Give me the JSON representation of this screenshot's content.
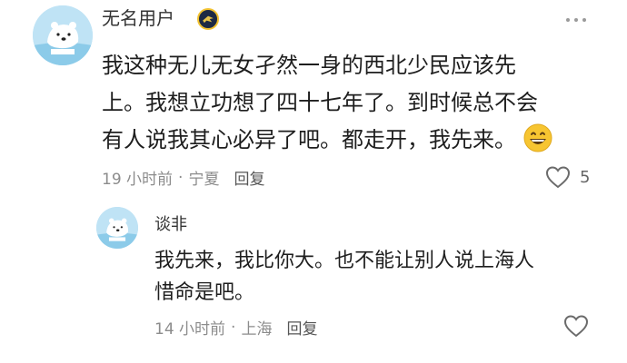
{
  "comment": {
    "username": "无名用户",
    "content_lines": [
      "我这种无儿无女孑然一身的西北少民应该先",
      "上。我想立功想了四十七年了。到时候总不会",
      "有人说我其心必异了吧。都走开，我先来。"
    ],
    "time": "19 小时前",
    "location": "宁夏",
    "reply_label": "回复",
    "like_count": "5"
  },
  "reply": {
    "username": "谈非",
    "content_lines": [
      "我先来，我比你大。也不能让别人说上海人",
      "惜命是吧。"
    ],
    "time": "14 小时前",
    "location": "上海",
    "reply_label": "回复"
  },
  "icons": {
    "avatar": "polar-bear-avatar-icon",
    "badge": "eagle-badge-icon",
    "more": "more-dots-icon",
    "like": "heart-outline-icon",
    "emoji": "grinning-face-emoji"
  },
  "colors": {
    "avatar_bg": "#bfe3f5",
    "meta_text": "#8c8c8c",
    "badge_bg": "#1d2a44",
    "badge_ring": "#f2c230"
  }
}
